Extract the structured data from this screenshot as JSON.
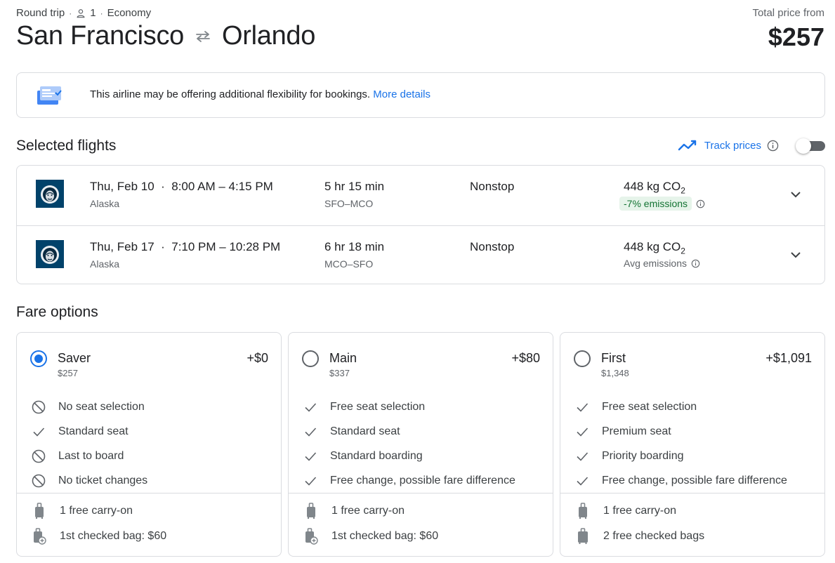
{
  "header": {
    "trip_type": "Round trip",
    "passengers": "1",
    "cabin": "Economy",
    "origin": "San Francisco",
    "destination": "Orlando",
    "total_label": "Total price from",
    "total_price": "$257"
  },
  "banner": {
    "text": "This airline may be offering additional flexibility for bookings.",
    "link": "More details"
  },
  "selected_flights": {
    "title": "Selected flights",
    "track_prices_label": "Track prices",
    "track_prices_enabled": false,
    "flights": [
      {
        "date": "Thu, Feb 10",
        "times": "8:00 AM – 4:15 PM",
        "airline": "Alaska",
        "duration": "5 hr 15 min",
        "route": "SFO–MCO",
        "stops": "Nonstop",
        "co2_value": "448 kg CO",
        "co2_sub": "2",
        "emissions": "-7% emissions"
      },
      {
        "date": "Thu, Feb 17",
        "times": "7:10 PM – 10:28 PM",
        "airline": "Alaska",
        "duration": "6 hr 18 min",
        "route": "MCO–SFO",
        "stops": "Nonstop",
        "co2_value": "448 kg CO",
        "co2_sub": "2",
        "emissions": "Avg emissions"
      }
    ]
  },
  "fare_options": {
    "title": "Fare options",
    "fares": [
      {
        "name": "Saver",
        "price": "$257",
        "delta": "+$0",
        "selected": true,
        "features": [
          {
            "icon": "block-icon",
            "text": "No seat selection"
          },
          {
            "icon": "check-icon",
            "text": "Standard seat"
          },
          {
            "icon": "block-icon",
            "text": "Last to board"
          },
          {
            "icon": "block-icon",
            "text": "No ticket changes"
          }
        ],
        "bags": [
          {
            "icon": "carry-on-icon",
            "text": "1 free carry-on"
          },
          {
            "icon": "checked-bag-fee-icon",
            "text": "1st checked bag: $60"
          }
        ]
      },
      {
        "name": "Main",
        "price": "$337",
        "delta": "+$80",
        "selected": false,
        "features": [
          {
            "icon": "check-icon",
            "text": "Free seat selection"
          },
          {
            "icon": "check-icon",
            "text": "Standard seat"
          },
          {
            "icon": "check-icon",
            "text": "Standard boarding"
          },
          {
            "icon": "check-icon",
            "text": "Free change, possible fare difference"
          }
        ],
        "bags": [
          {
            "icon": "carry-on-icon",
            "text": "1 free carry-on"
          },
          {
            "icon": "checked-bag-fee-icon",
            "text": "1st checked bag: $60"
          }
        ]
      },
      {
        "name": "First",
        "price": "$1,348",
        "delta": "+$1,091",
        "selected": false,
        "features": [
          {
            "icon": "check-icon",
            "text": "Free seat selection"
          },
          {
            "icon": "check-icon",
            "text": "Premium seat"
          },
          {
            "icon": "check-icon",
            "text": "Priority boarding"
          },
          {
            "icon": "check-icon",
            "text": "Free change, possible fare difference"
          }
        ],
        "bags": [
          {
            "icon": "carry-on-icon",
            "text": "1 free carry-on"
          },
          {
            "icon": "checked-bag-icon",
            "text": "2 free checked bags"
          }
        ]
      }
    ]
  },
  "colors": {
    "accent": "#1a73e8",
    "emissions_badge_bg": "#e6f4ea",
    "emissions_badge_text": "#137333",
    "airline_logo_bg": "#01426a"
  }
}
